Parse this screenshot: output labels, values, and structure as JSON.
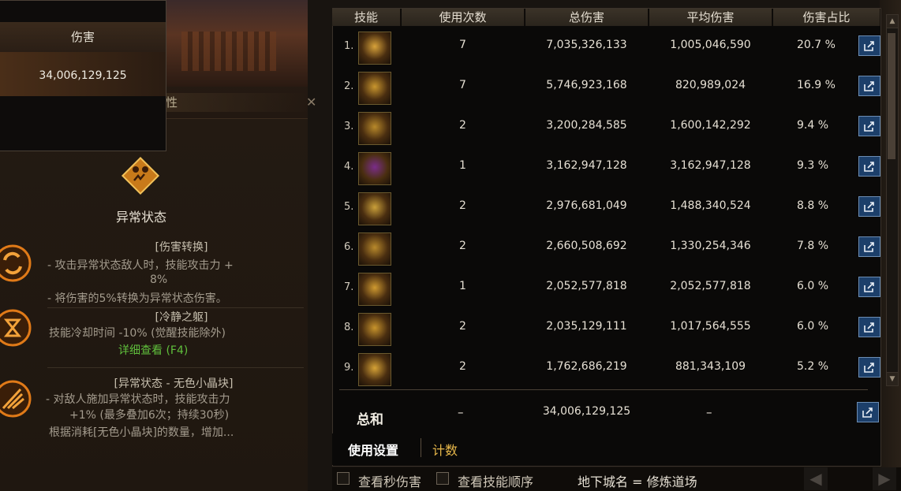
{
  "damage_box": {
    "header": "伤害",
    "value": "34,006,129,125"
  },
  "gear_panel": {
    "title": "装备特性",
    "status_name": "异常状态",
    "effects": [
      {
        "title": "[伤害转换]",
        "lines": [
          "- 攻击异常状态敌人时，技能攻击力 +",
          "8%",
          "- 将伤害的5%转换为异常状态伤害。"
        ]
      },
      {
        "title": "[冷静之躯]",
        "lines": [
          "技能冷却时间 -10% (觉醒技能除外)"
        ],
        "link": "详细查看 (F4)"
      },
      {
        "title": "[异常状态 - 无色小晶块]",
        "lines": [
          "- 对敌人施加异常状态时，技能攻击力",
          "+1% (最多叠加6次；持续30秒)",
          "根据消耗[无色小晶块]的数量，增加..."
        ]
      }
    ]
  },
  "table": {
    "headers": [
      "技能",
      "使用次数",
      "总伤害",
      "平均伤害",
      "伤害占比"
    ],
    "rows": [
      {
        "index": "1.",
        "icon": "cross-slash-skill-icon",
        "uses": "7",
        "total": "7,035,326,133",
        "avg": "1,005,046,590",
        "pct": "20.7 %"
      },
      {
        "index": "2.",
        "icon": "scroll-skill-icon",
        "uses": "7",
        "total": "5,746,923,168",
        "avg": "820,989,024",
        "pct": "16.9 %"
      },
      {
        "index": "3.",
        "icon": "pentagram-skill-icon",
        "uses": "2",
        "total": "3,200,284,585",
        "avg": "1,600,142,292",
        "pct": "9.4 %"
      },
      {
        "index": "4.",
        "icon": "demon-face-skill-icon",
        "uses": "1",
        "total": "3,162,947,128",
        "avg": "3,162,947,128",
        "pct": "9.3 %"
      },
      {
        "index": "5.",
        "icon": "rune-glyph-skill-icon",
        "uses": "2",
        "total": "2,976,681,049",
        "avg": "1,488,340,524",
        "pct": "8.8 %"
      },
      {
        "index": "6.",
        "icon": "seal-character-skill-icon",
        "uses": "2",
        "total": "2,660,508,692",
        "avg": "1,330,254,346",
        "pct": "7.8 %"
      },
      {
        "index": "7.",
        "icon": "flame-burst-skill-icon",
        "uses": "1",
        "total": "2,052,577,818",
        "avg": "2,052,577,818",
        "pct": "6.0 %"
      },
      {
        "index": "8.",
        "icon": "rising-blade-skill-icon",
        "uses": "2",
        "total": "2,035,129,111",
        "avg": "1,017,564,555",
        "pct": "6.0 %"
      },
      {
        "index": "9.",
        "icon": "explosion-skill-icon",
        "uses": "2",
        "total": "1,762,686,219",
        "avg": "881,343,109",
        "pct": "5.2 %"
      }
    ],
    "summary": {
      "label": "总和",
      "uses": "–",
      "total": "34,006,129,125",
      "avg": "–"
    }
  },
  "footer": {
    "tab_active": "使用设置",
    "tab_other": "计数"
  },
  "bottom_bar": {
    "per_second_label": "查看秒伤害",
    "skill_order_label": "查看技能顺序",
    "dungeon_label": "地下城名 = 修炼道场"
  },
  "colors": {
    "accent_gold": "#e8b84a",
    "link_green": "#5fbf3c",
    "button_blue": "#1c3f6a"
  }
}
